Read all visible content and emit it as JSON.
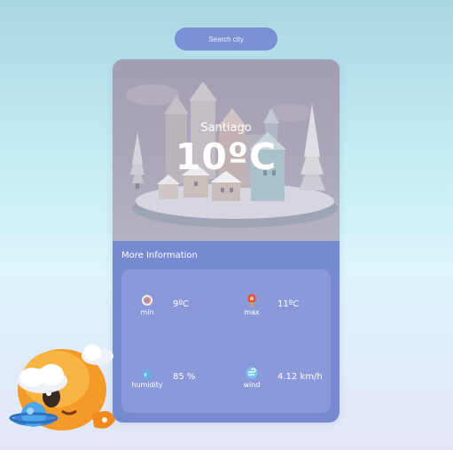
{
  "search": {
    "placeholder": "Search city"
  },
  "weather": {
    "city": "Santiago",
    "temperature": "10ºC"
  },
  "details": {
    "title": "More Information",
    "min": {
      "label": "min",
      "value": "9ºC",
      "icon": "thermometer-low-icon"
    },
    "max": {
      "label": "max",
      "value": "11ºC",
      "icon": "thermometer-high-icon"
    },
    "humidity": {
      "label": "humidity",
      "value": "85 %",
      "icon": "droplet-icon"
    },
    "wind": {
      "label": "wind",
      "value": "4.12 km/h",
      "icon": "wind-icon"
    }
  },
  "colors": {
    "accent": "#7b8fd6",
    "card": "#7689d1",
    "panel": "#8a99d9"
  }
}
